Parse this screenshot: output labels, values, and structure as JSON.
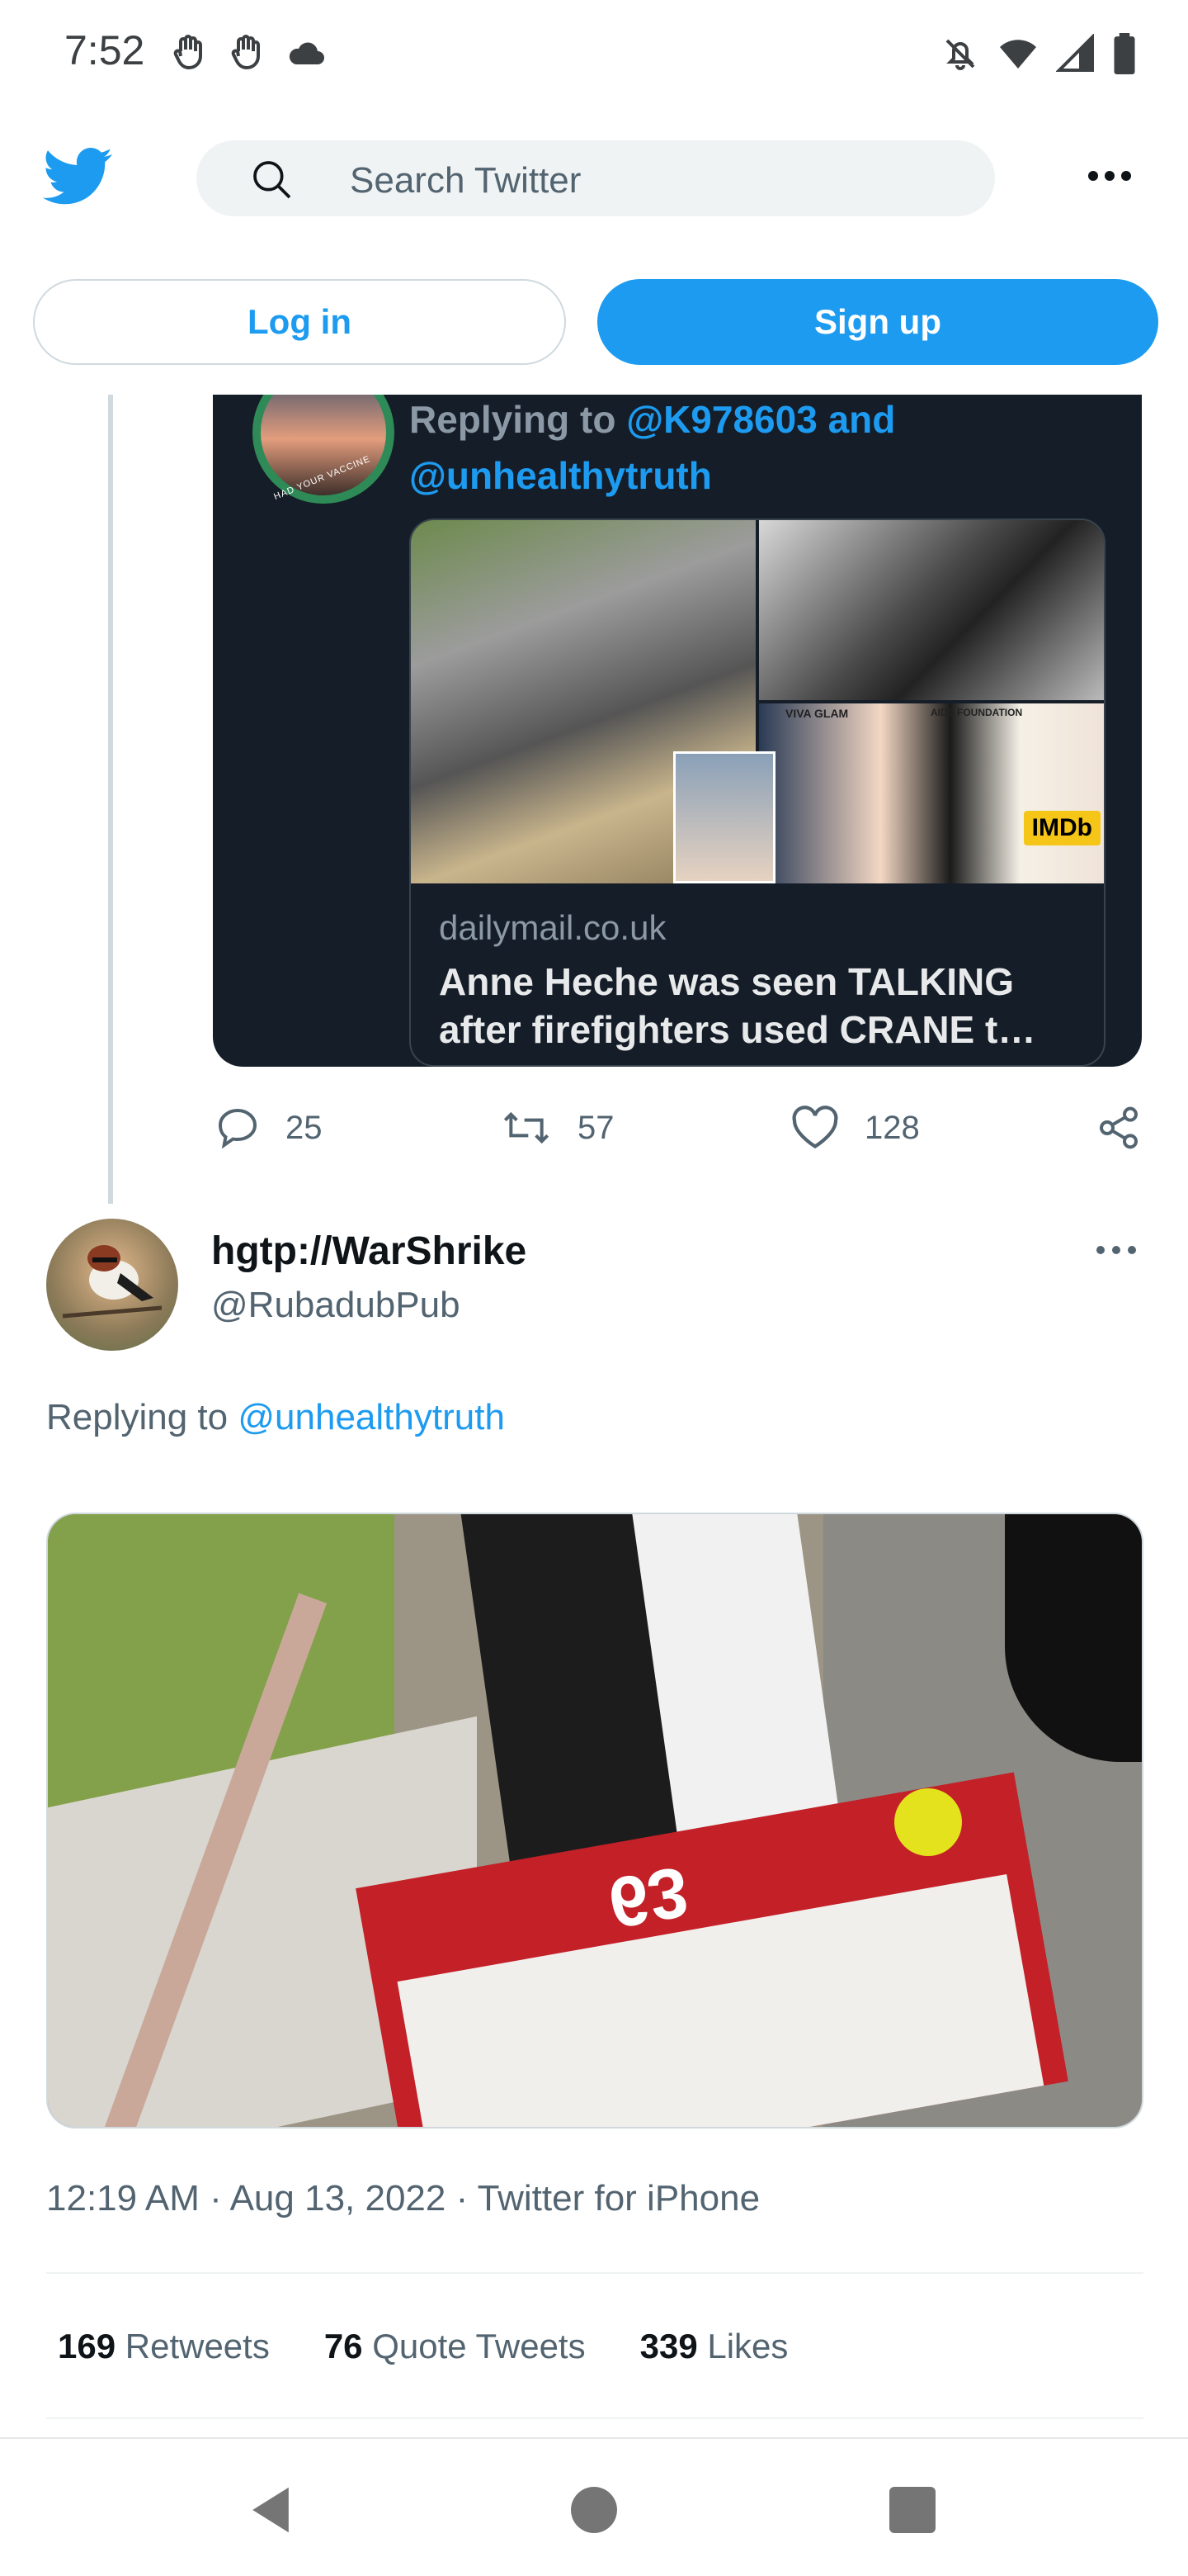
{
  "status_bar": {
    "time": "7:52",
    "left_icons": [
      "hand-icon",
      "hand-icon",
      "cloud-icon"
    ],
    "right_icons": [
      "bell-off-icon",
      "wifi-icon",
      "signal-icon",
      "battery-icon"
    ]
  },
  "header": {
    "search_placeholder": "Search Twitter"
  },
  "auth": {
    "login_label": "Log in",
    "signup_label": "Sign up"
  },
  "quoted_tweet": {
    "avatar_badge_text": "HAD YOUR VACCINE",
    "replying_prefix": "Replying to",
    "mention_1": "@K978603",
    "and_word": "and",
    "mention_2": "@unhealthytruth",
    "link_card": {
      "domain": "dailymail.co.uk",
      "title": "Anne Heche was seen TALKING after firefighters used CRANE t…",
      "image_texts": {
        "viva": "VIVA GLAM",
        "aids": "AIDS FOUNDATION",
        "imdb": "IMDb"
      }
    },
    "actions": {
      "replies": "25",
      "retweets": "57",
      "likes": "128"
    }
  },
  "main_tweet": {
    "author_name": "hgtp://WarShrike",
    "handle": "@RubadubPub",
    "replying_prefix": "Replying to",
    "replying_mention": "@unhealthytruth",
    "media_sign_number": "63",
    "timestamp": "12:19 AM · Aug 13, 2022 · Twitter for iPhone",
    "stats": {
      "retweets_count": "169",
      "retweets_label": "Retweets",
      "quotes_count": "76",
      "quotes_label": "Quote Tweets",
      "likes_count": "339",
      "likes_label": "Likes"
    }
  },
  "colors": {
    "accent": "#1d9bf0",
    "dark_card": "#151d28",
    "secondary_text": "#536471"
  }
}
